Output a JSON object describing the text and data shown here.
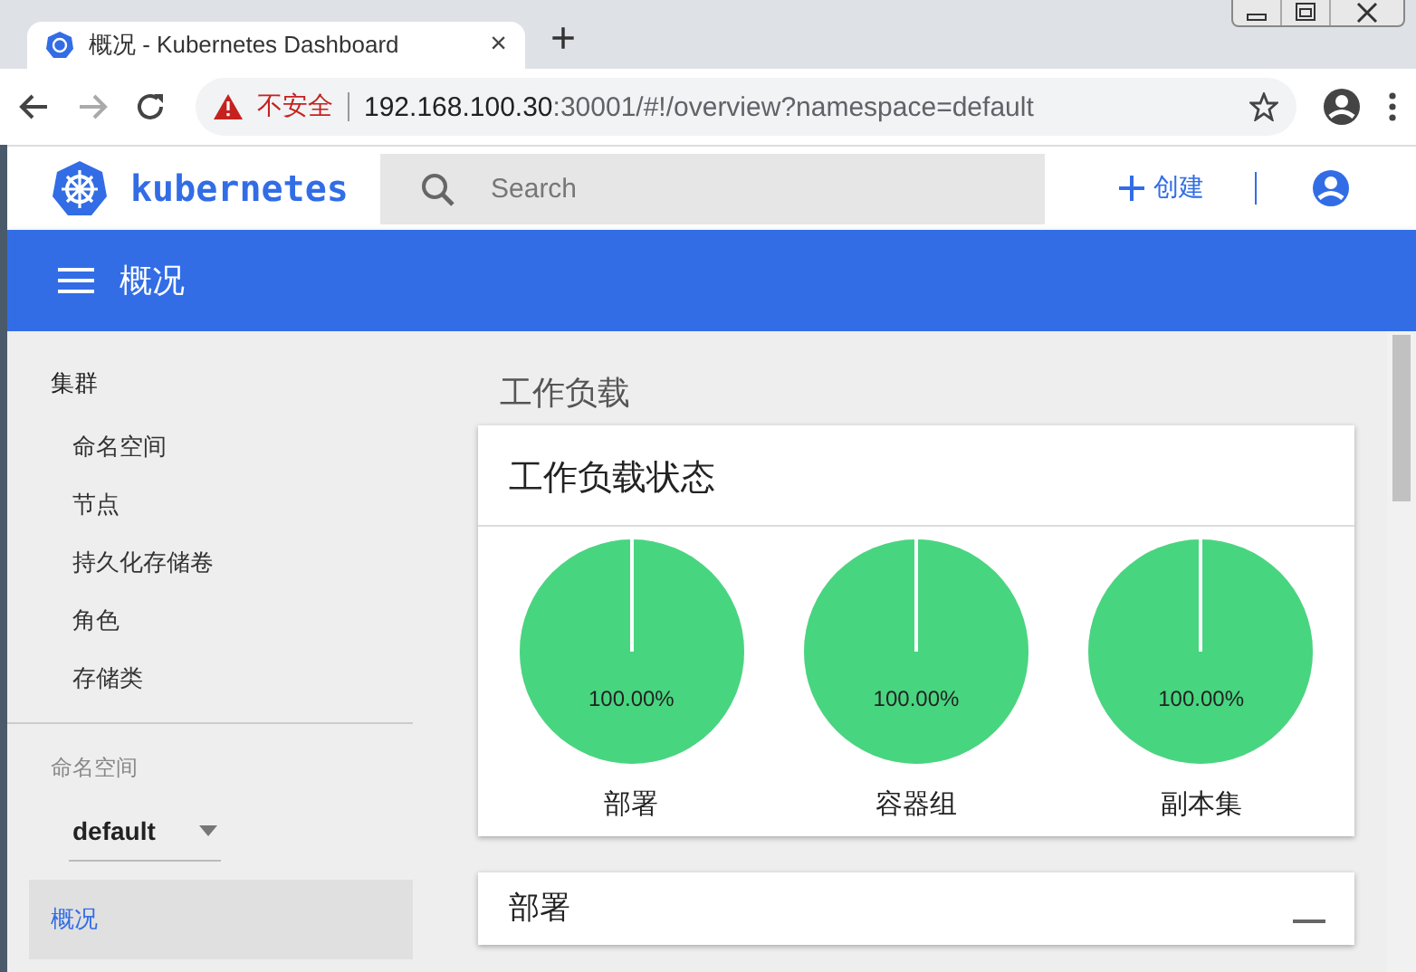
{
  "browser": {
    "tab": {
      "title": "概况 - Kubernetes Dashboard",
      "close": "×"
    },
    "new_tab": "+",
    "address": {
      "security_label": "不安全",
      "url_host": "192.168.100.30",
      "url_rest": ":30001/#!/overview?namespace=default"
    }
  },
  "header": {
    "logo_text": "kubernetes",
    "search": {
      "placeholder": "Search"
    },
    "create_button": "创建"
  },
  "toolbar": {
    "title": "概况"
  },
  "sidebar": {
    "section": "集群",
    "items": [
      {
        "label": "命名空间"
      },
      {
        "label": "节点"
      },
      {
        "label": "持久化存储卷"
      },
      {
        "label": "角色"
      },
      {
        "label": "存储类"
      }
    ],
    "namespace_label": "命名空间",
    "namespace_value": "default",
    "nav": [
      {
        "label": "概况",
        "selected": true
      }
    ]
  },
  "main": {
    "heading": "工作负载",
    "status_card": {
      "title": "工作负载状态",
      "pies": [
        {
          "level": 1,
          "reading": "100.00%",
          "label": "部署"
        },
        {
          "level": 1,
          "reading": "100.00%",
          "label": "容器组"
        },
        {
          "level": 1,
          "reading": "100.00%",
          "label": "副本集"
        }
      ]
    },
    "next_card": {
      "title": "部署"
    }
  }
}
